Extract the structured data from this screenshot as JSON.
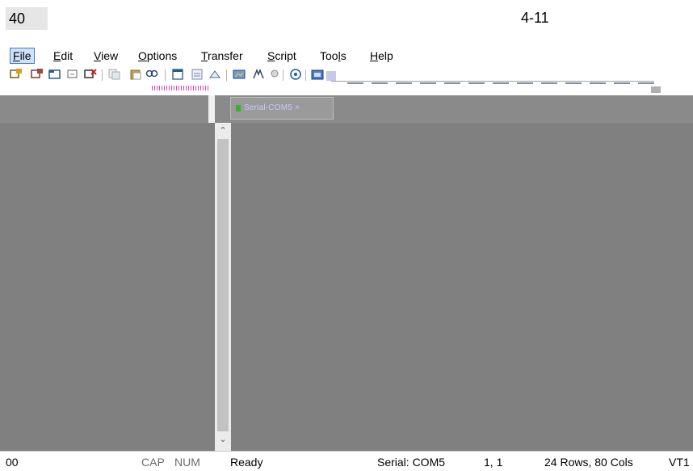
{
  "page": {
    "page_number": "40",
    "section_number": "4-11"
  },
  "menu": {
    "items": [
      {
        "pre": "",
        "u": "F",
        "post": "ile",
        "active": true
      },
      {
        "pre": "",
        "u": "E",
        "post": "dit"
      },
      {
        "pre": "",
        "u": "V",
        "post": "iew"
      },
      {
        "pre": "",
        "u": "O",
        "post": "ptions"
      },
      {
        "pre": "",
        "u": "T",
        "post": "ransfer"
      },
      {
        "pre": "",
        "u": "S",
        "post": "cript"
      },
      {
        "pre": "Too",
        "u": "l",
        "post": "s"
      },
      {
        "pre": "",
        "u": "H",
        "post": "elp"
      }
    ]
  },
  "toolbar": {
    "icons": [
      "connect-icon",
      "quick-connect-icon",
      "connect-tab-icon",
      "reconnect-icon",
      "disconnect-icon",
      "copy-icon",
      "paste-icon",
      "find-icon",
      "print-icon",
      "print-setup-icon",
      "session-options-icon",
      "global-options-icon",
      "keymap-icon",
      "sftp-icon",
      "help-icon",
      "about-icon"
    ]
  },
  "session_tab": {
    "label": "Serial-COM5 ×"
  },
  "status": {
    "left_code": "00",
    "cap": "CAP",
    "num": "NUM",
    "ready": "Ready",
    "connection": "Serial: COM5",
    "cursor": "1,  1",
    "size": "24 Rows,  80 Cols",
    "terminal_type": "VT1"
  },
  "colors": {
    "background_pane": "#808080",
    "menu_active": "#cfe3fc"
  }
}
